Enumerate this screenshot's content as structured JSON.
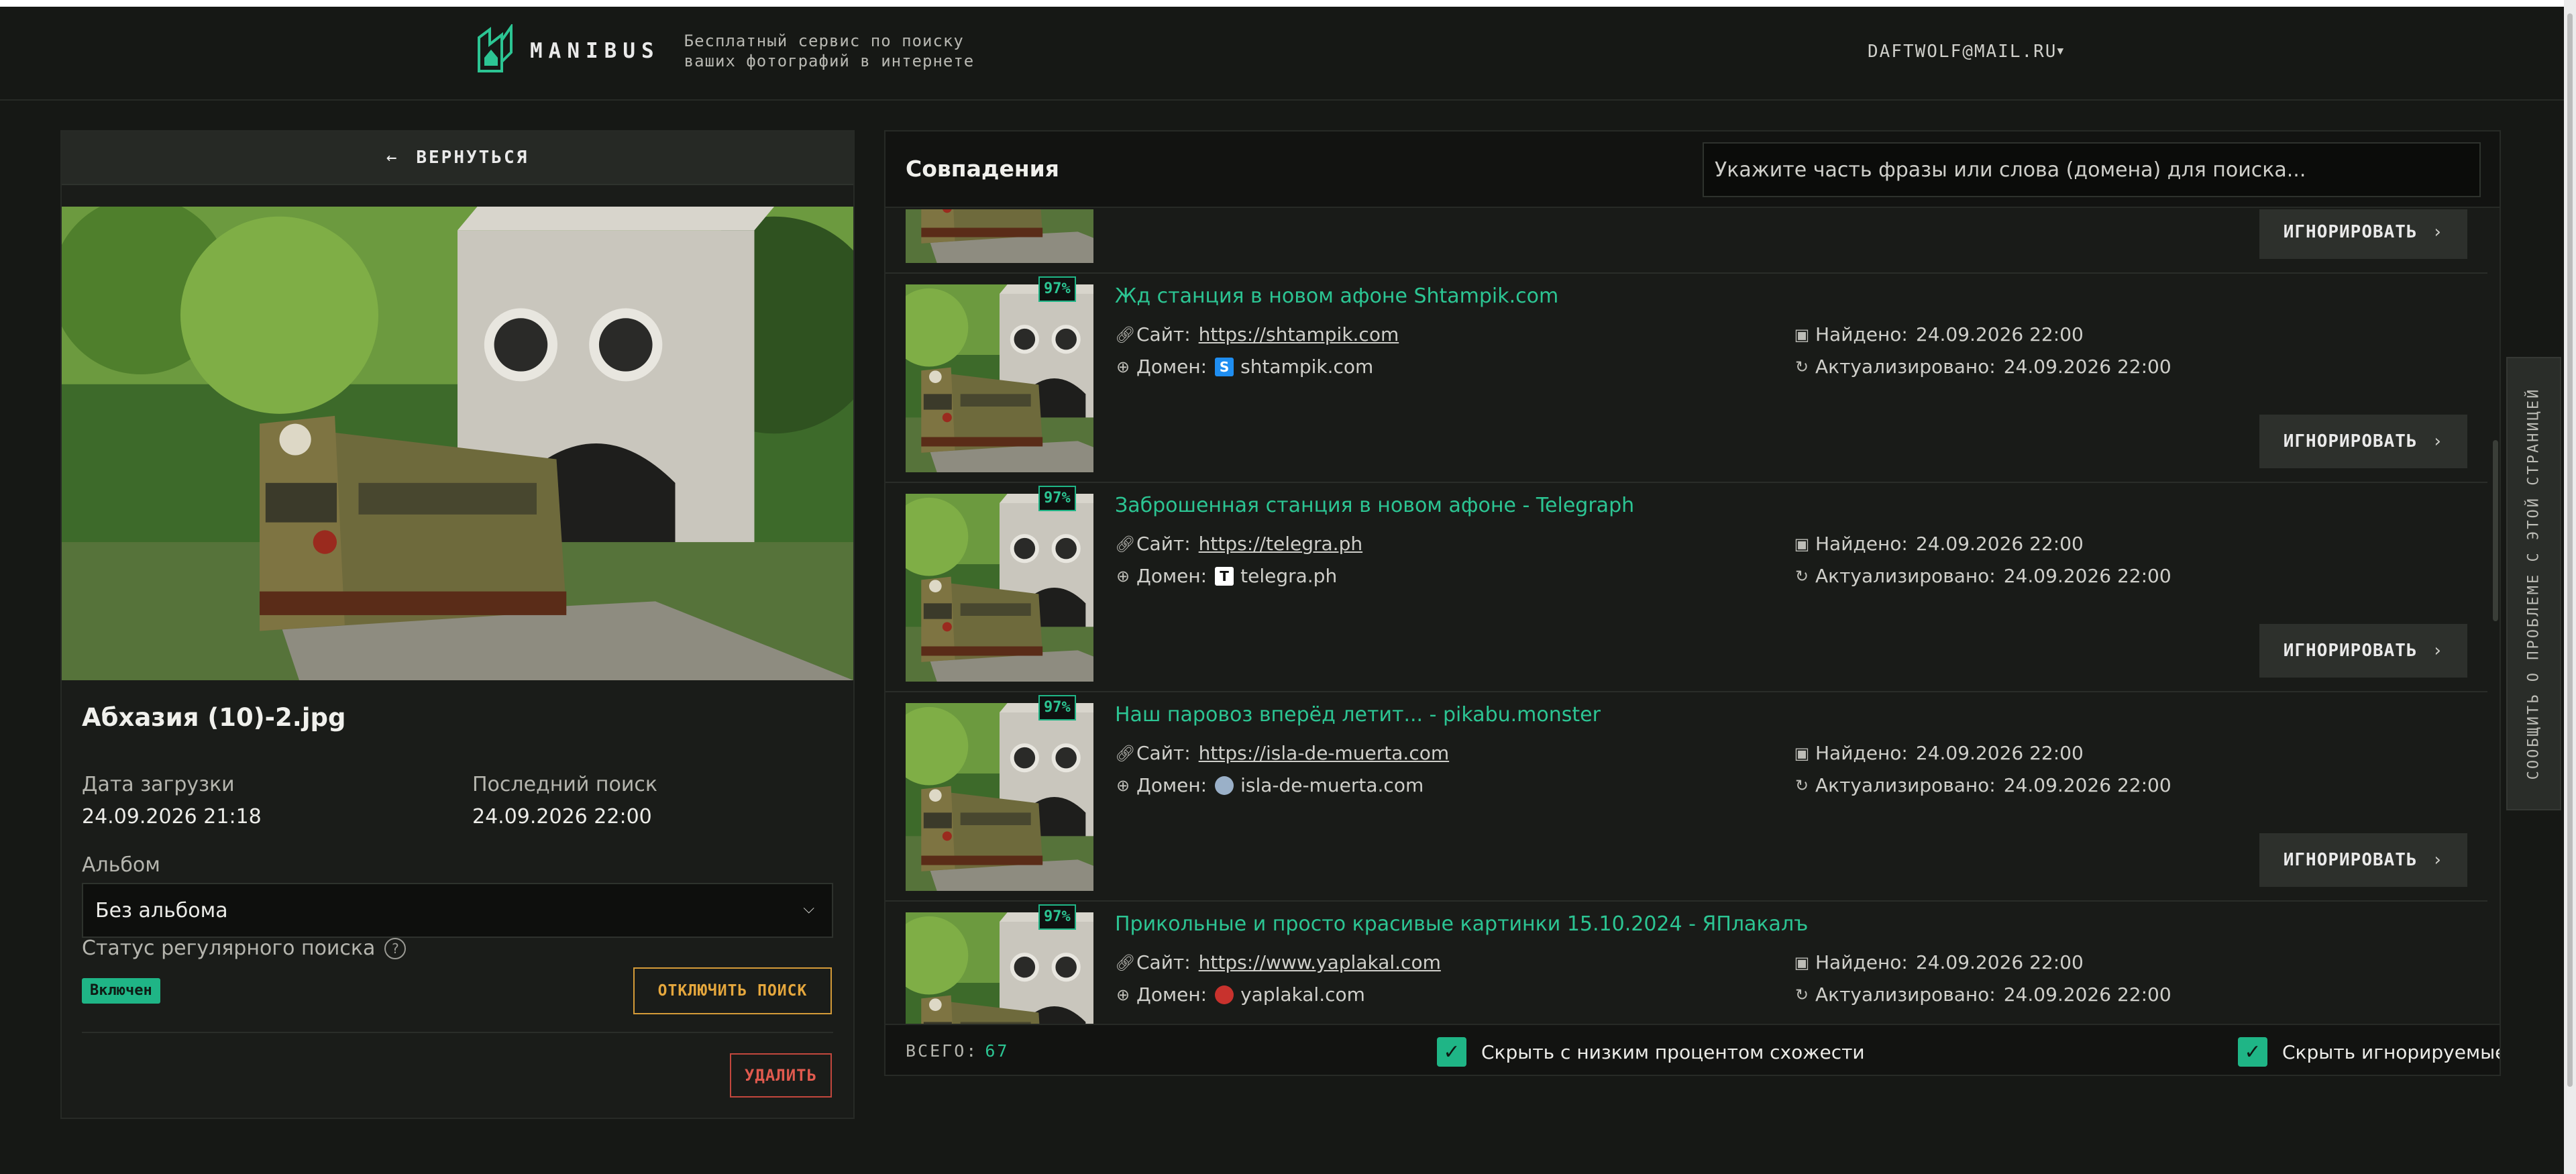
{
  "header": {
    "brand": "MANIBUS",
    "tagline_line1": "Бесплатный сервис по поиску",
    "tagline_line2": "ваших фотографий в интернете",
    "user_email": "DAFTWOLF@MAIL.RU"
  },
  "left_panel": {
    "back_label": "ВЕРНУТЬСЯ",
    "file_name": "Абхазия (10)-2.jpg",
    "upload_date_label": "Дата загрузки",
    "upload_date_value": "24.09.2026 21:18",
    "last_search_label": "Последний поиск",
    "last_search_value": "24.09.2026 22:00",
    "album_label": "Альбом",
    "album_value": "Без альбома",
    "regular_search_label": "Статус регулярного поиска",
    "regular_search_status": "Включен",
    "disable_search_label": "ОТКЛЮЧИТЬ ПОИСК",
    "delete_label": "УДАЛИТЬ"
  },
  "matches": {
    "title": "Совпадения",
    "search_placeholder": "Укажите часть фразы или слова (домена) для поиска...",
    "ignore_label": "ИГНОРИРОВАТЬ",
    "site_label": "Сайт:",
    "domain_label": "Домен:",
    "found_label": "Найдено:",
    "updated_label": "Актуализировано:",
    "items": [
      {
        "percent": "97%",
        "title": "Жд станция в новом афоне Shtampik.com",
        "site": "https://shtampik.com",
        "domain": "shtampik.com",
        "favicon": "S",
        "favicon_color": "#1f8ef1",
        "found": "24.09.2026 22:00",
        "updated": "24.09.2026 22:00"
      },
      {
        "percent": "97%",
        "title": "Заброшенная станция в новом афоне - Telegraph",
        "site": "https://telegra.ph",
        "domain": "telegra.ph",
        "favicon": "T",
        "favicon_color": "#ffffff",
        "found": "24.09.2026 22:00",
        "updated": "24.09.2026 22:00"
      },
      {
        "percent": "97%",
        "title": "Наш паровоз вперёд летит... - pikabu.monster",
        "site": "https://isla-de-muerta.com",
        "domain": "isla-de-muerta.com",
        "favicon": "",
        "favicon_color": "#9ab0c8",
        "found": "24.09.2026 22:00",
        "updated": "24.09.2026 22:00"
      },
      {
        "percent": "97%",
        "title": "Прикольные и просто красивые картинки 15.10.2024 - ЯПлакалъ",
        "site": "https://www.yaplakal.com",
        "domain": "yaplakal.com",
        "favicon": "",
        "favicon_color": "#c8322d",
        "found": "24.09.2026 22:00",
        "updated": "24.09.2026 22:00"
      }
    ],
    "total_label": "ВСЕГО:",
    "total_value": "67",
    "hide_low_label": "Скрыть с низким процентом схожести",
    "hide_ignored_label": "Скрыть игнорируемые"
  },
  "report_label": "СООБЩИТЬ О ПРОБЛЕМЕ С ЭТОЙ СТРАНИЦЕЙ",
  "colors": {
    "accent": "#1fb586",
    "link": "#2cc593",
    "warning": "#d49a38",
    "danger": "#c2473d"
  }
}
